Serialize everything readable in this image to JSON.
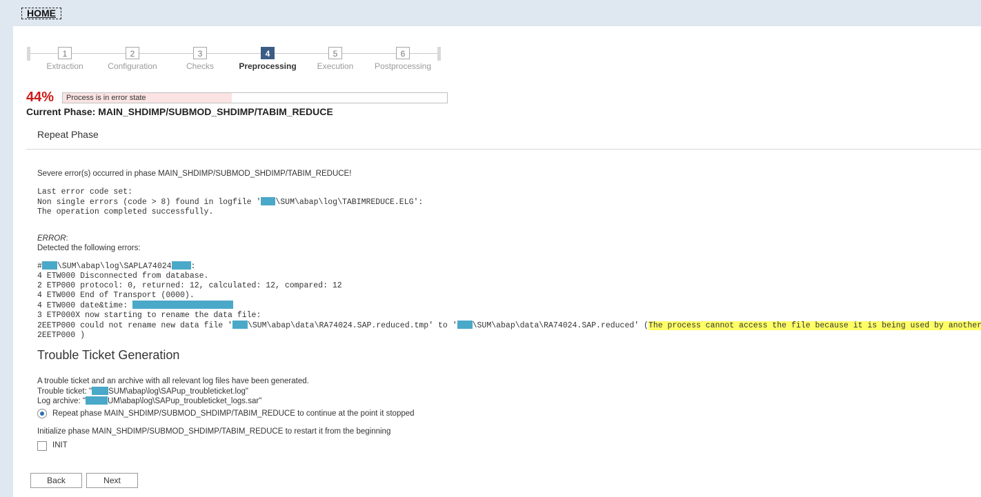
{
  "home": {
    "label": "HOME"
  },
  "steps": [
    {
      "number": "1",
      "label": "Extraction",
      "state": "done"
    },
    {
      "number": "2",
      "label": "Configuration",
      "state": "done"
    },
    {
      "number": "3",
      "label": "Checks",
      "state": "done"
    },
    {
      "number": "4",
      "label": "Preprocessing",
      "state": "active"
    },
    {
      "number": "5",
      "label": "Execution",
      "state": "pending"
    },
    {
      "number": "6",
      "label": "Postprocessing",
      "state": "pending"
    }
  ],
  "progress": {
    "percent_label": "44%",
    "percent": 44,
    "status_text": "Process is in error state",
    "fill_color": "#fbe3e3",
    "percent_color": "#cc1919"
  },
  "current_phase": "Current Phase: MAIN_SHDIMP/SUBMOD_SHDIMP/TABIM_REDUCE",
  "repeat_phase_title": "Repeat Phase",
  "error": {
    "headline": "Severe error(s) occurred in phase MAIN_SHDIMP/SUBMOD_SHDIMP/TABIM_REDUCE!",
    "last_error_label": "Last error code set:",
    "non_single_prefix": "Non single errors (code > 8) found in logfile '",
    "non_single_path": "\\SUM\\abap\\log\\TABIMREDUCE.ELG':",
    "operation_line": "The operation completed successfully.",
    "error_label": "ERROR",
    "error_colon": ":",
    "detected_line": "Detected the following errors:",
    "log_prefix": "#",
    "log_path": "\\SUM\\abap\\log\\SAPLA74024",
    "log_suffix": ":",
    "log_lines": [
      "4 ETW000 Disconnected from database.",
      "2 ETP000 protocol: 0, returned: 12, calculated: 12, compared: 12",
      "4 ETW000 End of Transport (0000)."
    ],
    "datetime_label": "4 ETW000 date&time: ",
    "rename_start_line": "3 ETP000X now starting to rename the data file:",
    "rename_error_prefix": "2EETP000 could not rename new data file '",
    "rename_error_from": "\\SUM\\abap\\data\\RA74024.SAP.reduced.tmp' to '",
    "rename_error_to": "\\SUM\\abap\\data\\RA74024.SAP.reduced' (",
    "rename_error_highlight": "The process cannot access the file because it is being used by another process.",
    "rename_error_end": "2EETP000 )",
    "highlight_color": "#ffff66",
    "redaction_color": "#4aa8c8"
  },
  "trouble_ticket": {
    "title": "Trouble Ticket Generation",
    "intro": "A trouble ticket and an archive with all relevant log files have been generated.",
    "ticket_label": "Trouble ticket: \"",
    "ticket_path": "SUM\\abap\\log\\SAPup_troubleticket.log\"",
    "archive_label": "Log archive: \"",
    "archive_path": "UM\\abap\\log\\SAPup_troubleticket_logs.sar\""
  },
  "options": {
    "repeat_label": "Repeat phase MAIN_SHDIMP/SUBMOD_SHDIMP/TABIM_REDUCE to continue at the point it stopped",
    "init_intro": "Initialize phase MAIN_SHDIMP/SUBMOD_SHDIMP/TABIM_REDUCE to restart it from the beginning",
    "init_label": "INIT"
  },
  "buttons": {
    "back": "Back",
    "next": "Next"
  }
}
